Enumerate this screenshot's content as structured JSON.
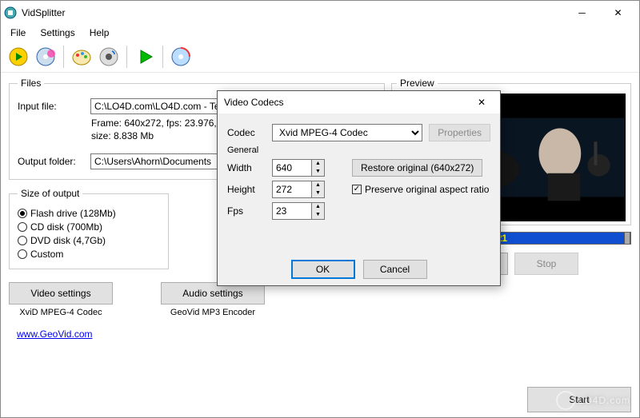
{
  "window": {
    "title": "VidSplitter"
  },
  "menu": {
    "file": "File",
    "settings": "Settings",
    "help": "Help"
  },
  "files_group": {
    "legend": "Files",
    "input_label": "Input file:",
    "input_value": "C:\\LO4D.com\\LO4D.com - Test.avi",
    "browse": "...",
    "info_line1": "Frame: 640x272, fps: 23.976,",
    "info_line2": "size: 8.838 Mb",
    "output_label": "Output folder:",
    "output_value": "C:\\Users\\Ahorn\\Documents"
  },
  "size_group": {
    "legend": "Size of output",
    "opt_flash": "Flash drive (128Mb)",
    "opt_cd": "CD disk (700Mb)",
    "opt_dvd": "DVD disk (4,7Gb)",
    "opt_custom": "Custom"
  },
  "buttons": {
    "video_settings": "Video settings",
    "audio_settings": "Audio settings",
    "play": "Play",
    "stop": "Stop",
    "start": "Start"
  },
  "captions": {
    "video_codec": "XviD MPEG-4 Codec",
    "audio_codec": "GeoVid MP3 Encoder"
  },
  "preview": {
    "legend": "Preview",
    "time": "0:0:21"
  },
  "link": "www.GeoVid.com",
  "modal": {
    "title": "Video Codecs",
    "codec_label": "Codec",
    "codec_value": "Xvid MPEG-4 Codec",
    "properties": "Properties",
    "general": "General",
    "width_label": "Width",
    "width_value": "640",
    "height_label": "Height",
    "height_value": "272",
    "fps_label": "Fps",
    "fps_value": "23",
    "restore": "Restore original (640x272)",
    "preserve": "Preserve original aspect ratio",
    "ok": "OK",
    "cancel": "Cancel"
  },
  "watermark": "LO4D.com"
}
